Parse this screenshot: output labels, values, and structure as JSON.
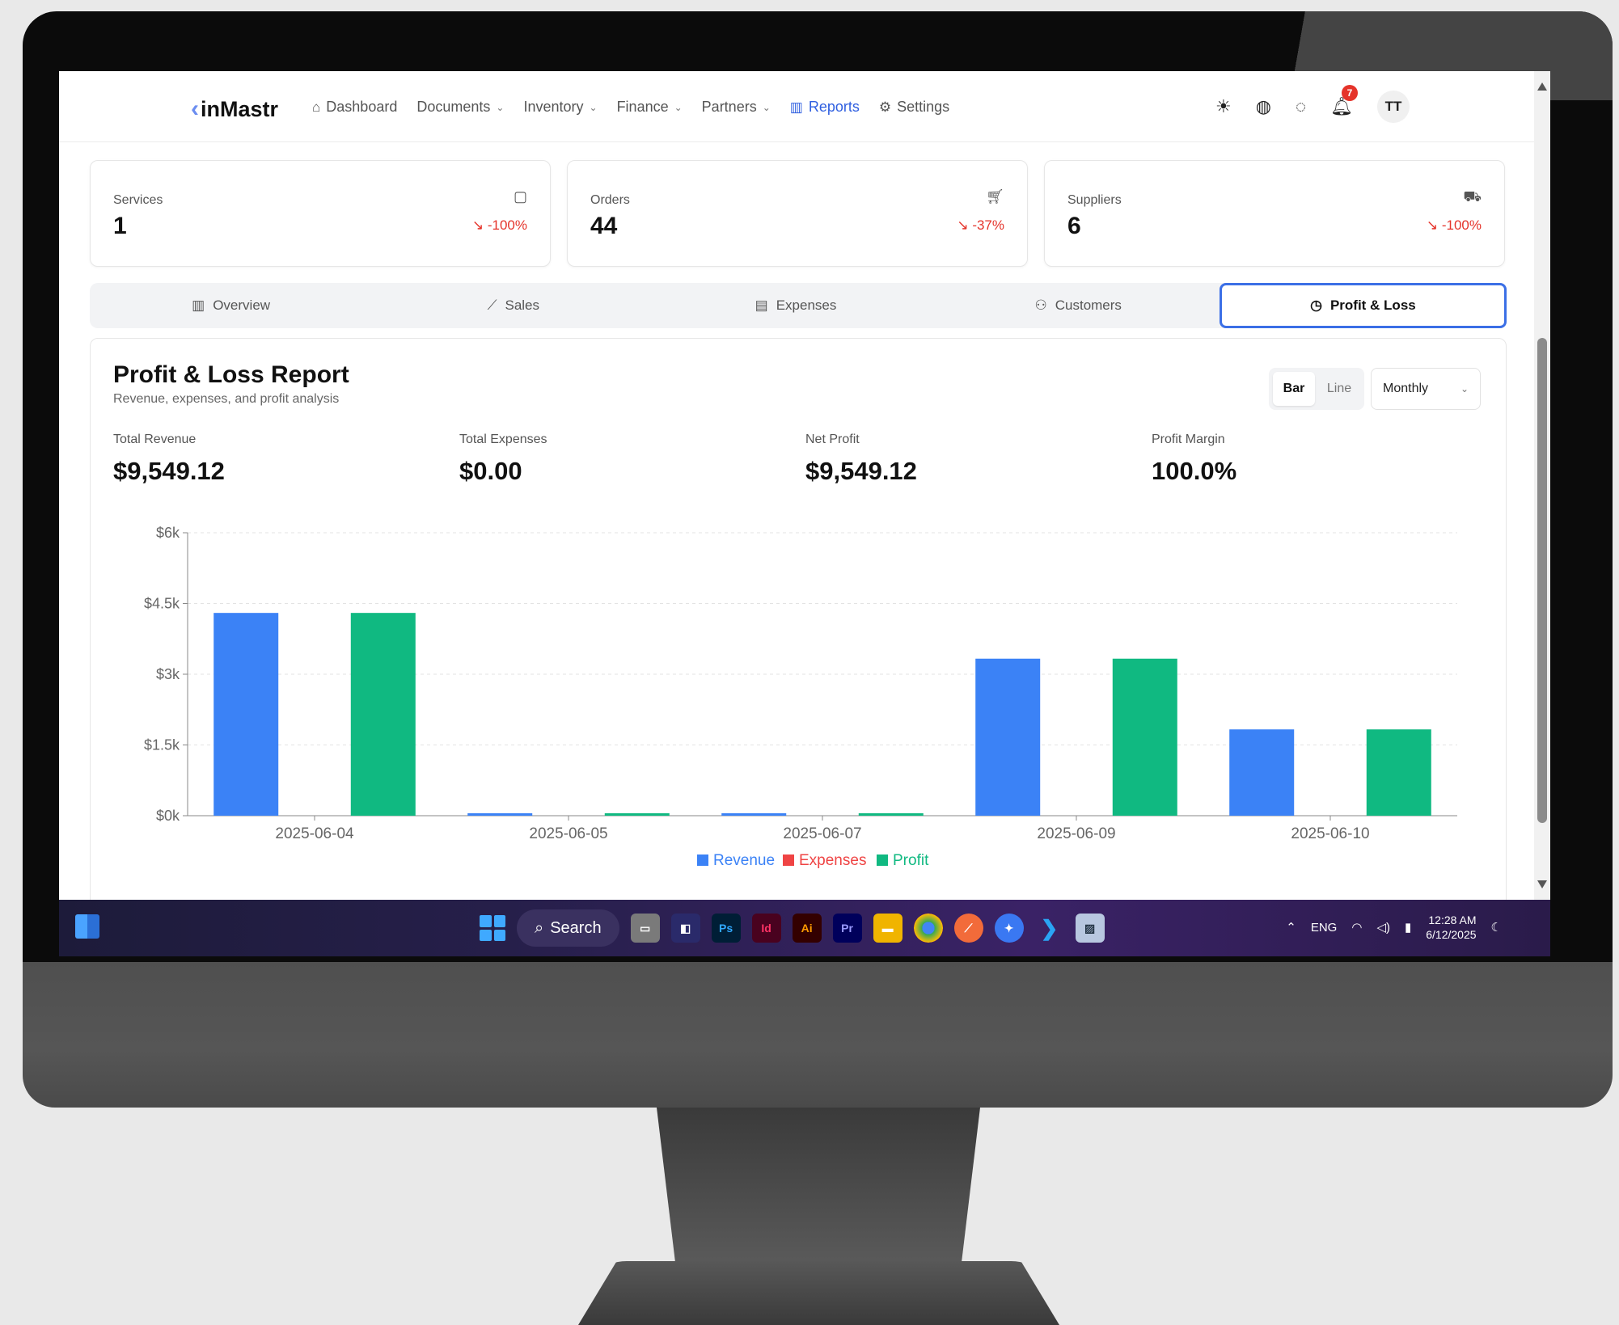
{
  "app": {
    "logo": "inMastr",
    "nav": [
      {
        "label": "Dashboard",
        "icon": "home-icon"
      },
      {
        "label": "Documents",
        "icon": "",
        "dropdown": true
      },
      {
        "label": "Inventory",
        "icon": "",
        "dropdown": true
      },
      {
        "label": "Finance",
        "icon": "",
        "dropdown": true
      },
      {
        "label": "Partners",
        "icon": "",
        "dropdown": true
      },
      {
        "label": "Reports",
        "icon": "bar-chart-icon",
        "active": true
      },
      {
        "label": "Settings",
        "icon": "gear-icon"
      }
    ],
    "notifications_count": "7",
    "avatar_initials": "TT"
  },
  "stats": [
    {
      "label": "Services",
      "value": "1",
      "change": "-100%",
      "icon": "box-icon"
    },
    {
      "label": "Orders",
      "value": "44",
      "change": "-37%",
      "icon": "cart-icon"
    },
    {
      "label": "Suppliers",
      "value": "6",
      "change": "-100%",
      "icon": "truck-icon"
    }
  ],
  "tabs": [
    {
      "label": "Overview",
      "icon": "bar-chart-icon"
    },
    {
      "label": "Sales",
      "icon": "line-chart-icon"
    },
    {
      "label": "Expenses",
      "icon": "receipt-icon"
    },
    {
      "label": "Customers",
      "icon": "users-icon"
    },
    {
      "label": "Profit & Loss",
      "icon": "dollar-circle-icon",
      "active": true
    }
  ],
  "report": {
    "title": "Profit & Loss Report",
    "subtitle": "Revenue, expenses, and profit analysis",
    "chart_type_options": [
      "Bar",
      "Line"
    ],
    "chart_type_selected": "Bar",
    "period": "Monthly",
    "metrics": [
      {
        "label": "Total Revenue",
        "value": "$9,549.12"
      },
      {
        "label": "Total Expenses",
        "value": "$0.00"
      },
      {
        "label": "Net Profit",
        "value": "$9,549.12"
      },
      {
        "label": "Profit Margin",
        "value": "100.0%"
      }
    ]
  },
  "chart_data": {
    "type": "bar",
    "categories": [
      "2025-06-04",
      "2025-06-05",
      "2025-06-07",
      "2025-06-09",
      "2025-06-10"
    ],
    "series": [
      {
        "name": "Revenue",
        "values": [
          4300,
          40,
          40,
          3330,
          1830
        ],
        "color": "#3b82f6"
      },
      {
        "name": "Expenses",
        "values": [
          0,
          0,
          0,
          0,
          0
        ],
        "color": "#ef4444"
      },
      {
        "name": "Profit",
        "values": [
          4300,
          40,
          40,
          3330,
          1830
        ],
        "color": "#10b981"
      }
    ],
    "ylim": [
      0,
      6000
    ],
    "yticks": [
      0,
      1500,
      3000,
      4500,
      6000
    ],
    "ytick_labels": [
      "$0k",
      "$1.5k",
      "$3k",
      "$4.5k",
      "$6k"
    ],
    "grid": true,
    "legend_position": "bottom"
  },
  "taskbar": {
    "search_label": "Search",
    "apps": [
      {
        "name": "file-explorer",
        "label": "",
        "color": "#f0b400"
      },
      {
        "name": "photoshop",
        "label": "Ps",
        "color": "#001e36"
      },
      {
        "name": "indesign",
        "label": "Id",
        "color": "#49021f"
      },
      {
        "name": "illustrator",
        "label": "Ai",
        "color": "#330000"
      },
      {
        "name": "premiere",
        "label": "Pr",
        "color": "#00005b"
      }
    ],
    "lang": "ENG",
    "time": "12:28 AM",
    "date": "6/12/2025"
  }
}
